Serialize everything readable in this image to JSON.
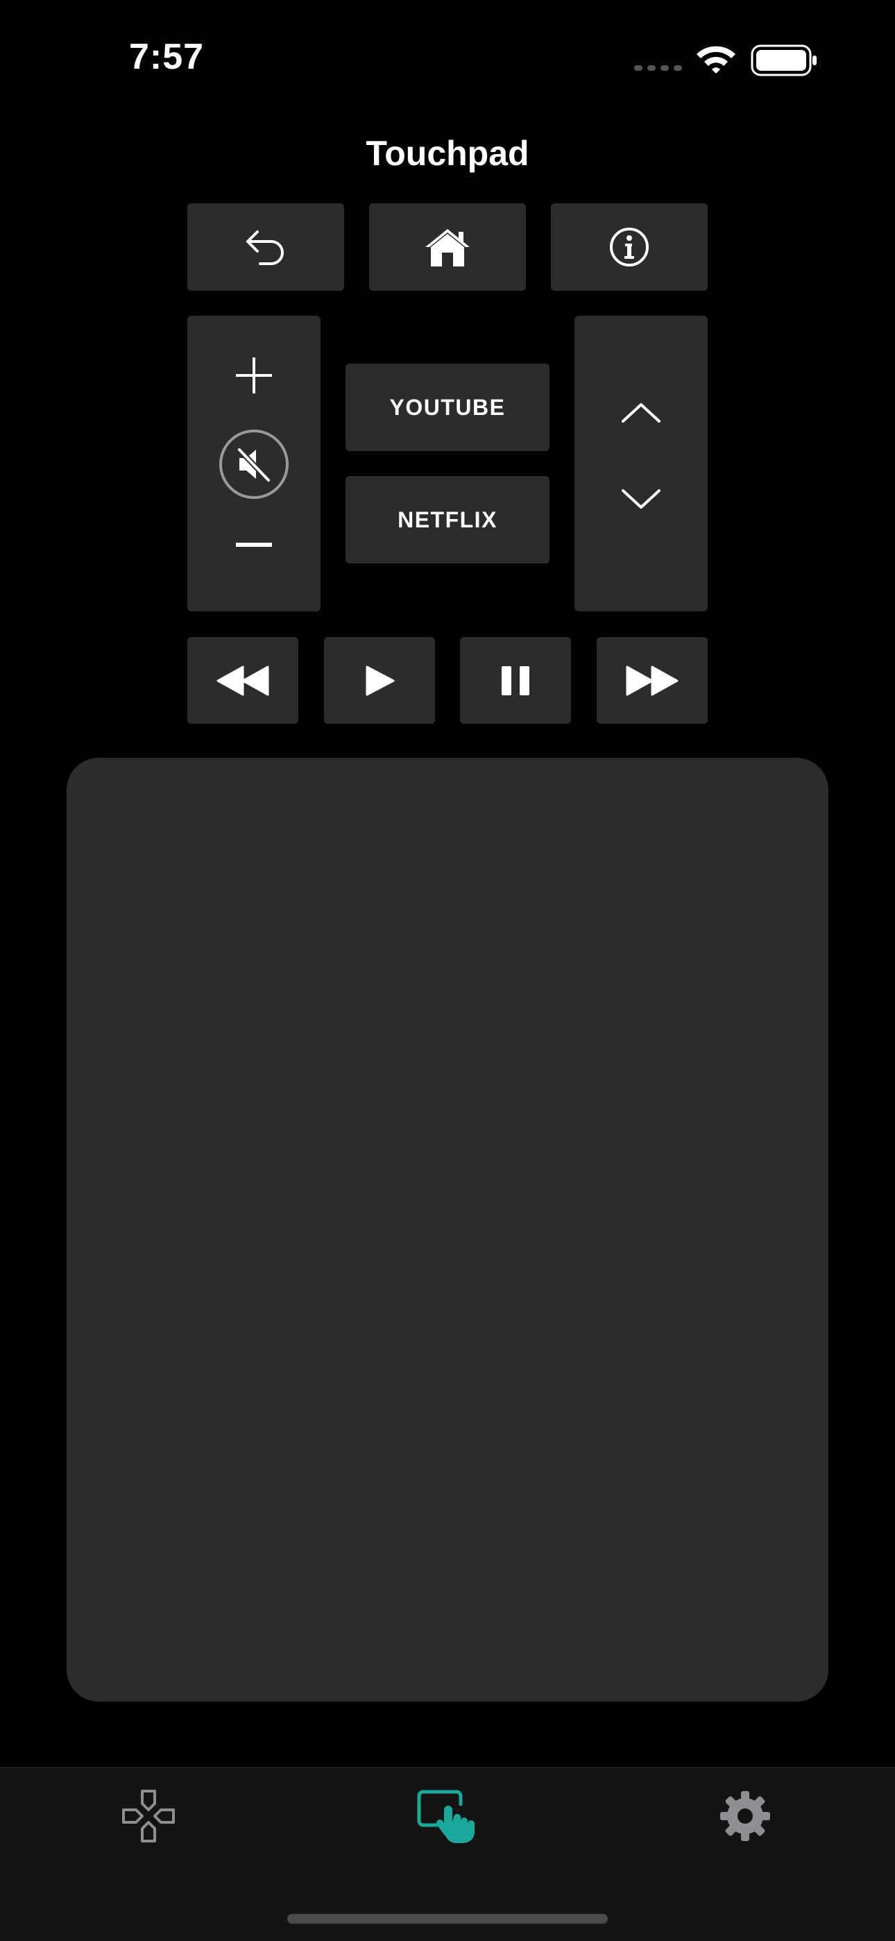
{
  "status_bar": {
    "time": "7:57",
    "icons": [
      "signal-dots-icon",
      "wifi-icon",
      "battery-icon"
    ]
  },
  "screen": {
    "title": "Touchpad"
  },
  "nav_row": [
    {
      "name": "back-button",
      "icon": "back-arrow-icon"
    },
    {
      "name": "home-button",
      "icon": "home-icon"
    },
    {
      "name": "info-button",
      "icon": "info-icon"
    }
  ],
  "volume": {
    "up_icon": "plus-icon",
    "mute_icon": "mute-icon",
    "down_icon": "minus-icon"
  },
  "apps": {
    "youtube_label": "YOUTUBE",
    "netflix_label": "NETFLIX"
  },
  "channel": {
    "up_icon": "chevron-up-icon",
    "down_icon": "chevron-down-icon"
  },
  "media_controls": [
    {
      "name": "rewind-button",
      "icon": "rewind-icon"
    },
    {
      "name": "play-button",
      "icon": "play-icon"
    },
    {
      "name": "pause-button",
      "icon": "pause-icon"
    },
    {
      "name": "fast-forward-button",
      "icon": "fast-forward-icon"
    }
  ],
  "tab_bar": {
    "tabs": [
      {
        "name": "tab-remote",
        "icon": "dpad-icon",
        "active": false
      },
      {
        "name": "tab-touchpad",
        "icon": "touchpad-hand-icon",
        "active": true
      },
      {
        "name": "tab-settings",
        "icon": "gear-icon",
        "active": false
      }
    ],
    "colors": {
      "active": "#1aa79c",
      "inactive": "#8e8e93"
    }
  },
  "colors": {
    "background": "#000000",
    "button": "#2c2c2e",
    "tab_bar": "#141414"
  }
}
